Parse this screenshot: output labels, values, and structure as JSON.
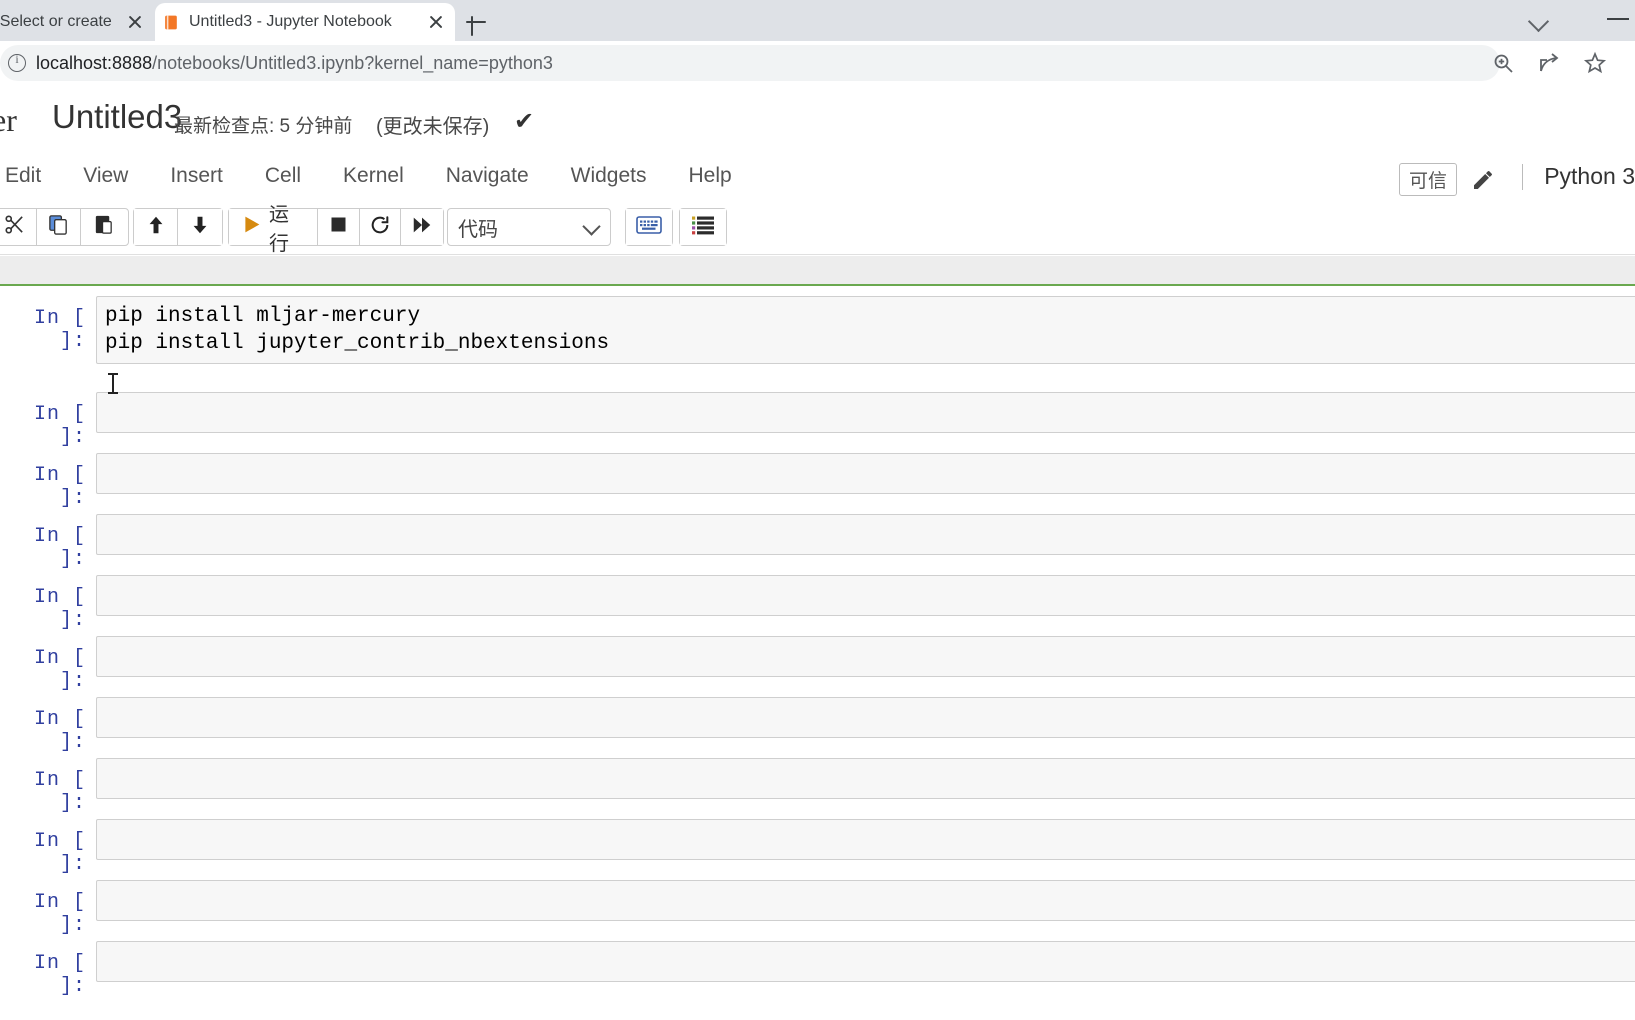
{
  "browser": {
    "tabs": [
      {
        "title": "- Select or create",
        "favicon": "none",
        "active": false
      },
      {
        "title": "Untitled3 - Jupyter Notebook",
        "favicon": "jupyter-book-icon",
        "active": true
      }
    ],
    "new_tab_label": "+",
    "tab_list_icon": "chevron-down-icon",
    "minimize_icon": "window-minimize-icon",
    "url_prefix": "localhost:8888",
    "url_rest": "/notebooks/Untitled3.ipynb?kernel_name=python3",
    "site_info_icon": "info-circle-icon",
    "omnibox_actions": [
      "zoom-icon",
      "share-icon",
      "bookmark-star-icon"
    ],
    "extensions_icon": "puzzle-piece-icon"
  },
  "jupyter": {
    "logo_text": "er",
    "notebook_name": "Untitled3",
    "checkpoint_text": "最新检查点: 5 分钟前",
    "dirty_text": "(更改未保存)",
    "saved_check_icon": "checkmark-icon",
    "python_logo_icon": "python-logo-icon",
    "menu": [
      {
        "label": "Edit"
      },
      {
        "label": "View"
      },
      {
        "label": "Insert"
      },
      {
        "label": "Cell"
      },
      {
        "label": "Kernel"
      },
      {
        "label": "Navigate"
      },
      {
        "label": "Widgets"
      },
      {
        "label": "Help"
      }
    ],
    "trust_badge": "可信",
    "edit_mode_icon": "pencil-icon",
    "kernel_name": "Python 3",
    "toolbar": {
      "cut_icon": "scissors-icon",
      "copy_icon": "copy-icon",
      "paste_icon": "paste-icon",
      "move_up_icon": "arrow-up-icon",
      "move_down_icon": "arrow-down-icon",
      "run_label": "运行",
      "run_icon": "play-icon",
      "stop_icon": "stop-square-icon",
      "restart_icon": "restart-circle-icon",
      "restart_run_all_icon": "fast-forward-icon",
      "cell_type": "代码",
      "cell_type_chevron": "chevron-down-icon",
      "keyboard_icon": "keyboard-icon",
      "toc_icon": "table-of-contents-icon"
    }
  },
  "notebook": {
    "prompt_label": "In [ ]:",
    "cells": [
      {
        "prompt": "In [ ]:",
        "selected": true,
        "lines": [
          "pip install mljar-mercury",
          "pip install jupyter_contrib_nbextensions"
        ]
      },
      {
        "prompt": "In [ ]:",
        "selected": false,
        "lines": []
      },
      {
        "prompt": "In [ ]:",
        "selected": false,
        "lines": []
      },
      {
        "prompt": "In [ ]:",
        "selected": false,
        "lines": []
      },
      {
        "prompt": "In [ ]:",
        "selected": false,
        "lines": []
      },
      {
        "prompt": "In [ ]:",
        "selected": false,
        "lines": []
      },
      {
        "prompt": "In [ ]:",
        "selected": false,
        "lines": []
      },
      {
        "prompt": "In [ ]:",
        "selected": false,
        "lines": []
      },
      {
        "prompt": "In [ ]:",
        "selected": false,
        "lines": []
      },
      {
        "prompt": "In [ ]:",
        "selected": false,
        "lines": []
      },
      {
        "prompt": "In [ ]:",
        "selected": false,
        "lines": []
      }
    ]
  },
  "colors": {
    "tabstrip": "#dee1e6",
    "omnibox": "#f1f3f4",
    "selection_green": "#6aa84f",
    "prompt_blue": "#303f9f",
    "cell_bg": "#f7f7f7"
  }
}
